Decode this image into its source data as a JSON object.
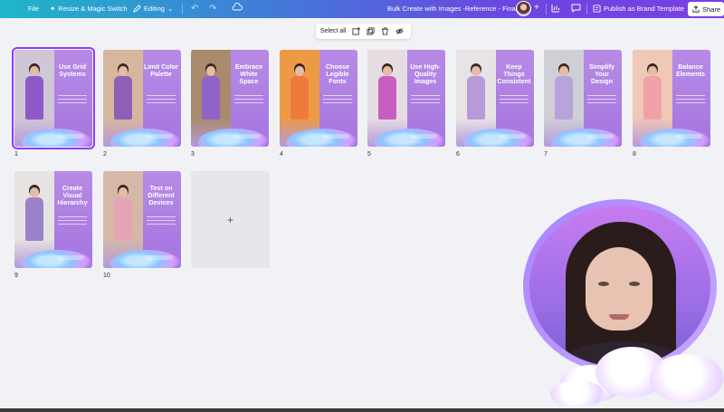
{
  "topbar": {
    "file": "File",
    "resize": "Resize & Magic Switch",
    "editing": "Editing",
    "title": "Bulk Create with Images -Reference - Final",
    "brand_template": "Publish as Brand Template",
    "share": "Share"
  },
  "selection_toolbar": {
    "select_all": "Select all"
  },
  "pages": [
    {
      "num": "1",
      "title": "Use Grid Systems",
      "outfit": "#8e59c9",
      "bg": "#cfc6d6",
      "selected": true
    },
    {
      "num": "2",
      "title": "Limit Color Palette",
      "outfit": "#8c5fb8",
      "bg": "#d8b69e",
      "selected": false
    },
    {
      "num": "3",
      "title": "Embrace White Space",
      "outfit": "#8f63c8",
      "bg": "#a98a6c",
      "selected": false
    },
    {
      "num": "4",
      "title": "Choose Legible Fonts",
      "outfit": "#f07a3a",
      "bg": "#ee9a45",
      "selected": false
    },
    {
      "num": "5",
      "title": "Use High-Quality Images",
      "outfit": "#c65fc0",
      "bg": "#e6dde3",
      "selected": false
    },
    {
      "num": "6",
      "title": "Keep Things Consistent",
      "outfit": "#b89ad8",
      "bg": "#e8e4e6",
      "selected": false
    },
    {
      "num": "7",
      "title": "Simplify Your Design",
      "outfit": "#b9a3dc",
      "bg": "#cfd0d6",
      "selected": false
    },
    {
      "num": "8",
      "title": "Balance Elements",
      "outfit": "#f2a2a6",
      "bg": "#f0c8b6",
      "selected": false
    },
    {
      "num": "9",
      "title": "Create Visual Hierarchy",
      "outfit": "#9a82c8",
      "bg": "#e7e3e3",
      "selected": false
    },
    {
      "num": "10",
      "title": "Test on Different Devices",
      "outfit": "#e6a4b6",
      "bg": "#d5b8a8",
      "selected": false
    }
  ],
  "add_page": "+",
  "colors": {
    "accent": "#8b3dff",
    "card_purple": "#b88ae6"
  }
}
